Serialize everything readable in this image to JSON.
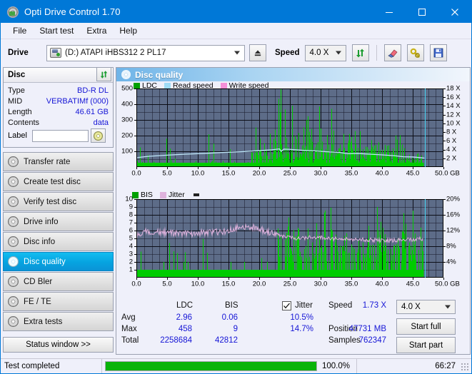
{
  "window": {
    "title": "Opti Drive Control 1.70",
    "icon": "disc-icon",
    "minimize": "—",
    "maximize": "□",
    "close": "✕"
  },
  "menu": {
    "items": [
      "File",
      "Start test",
      "Extra",
      "Help"
    ]
  },
  "toolbar": {
    "drive_label": "Drive",
    "drive_value": "(D:)  ATAPI iHBS312  2 PL17",
    "eject_title": "Eject",
    "speed_label": "Speed",
    "speed_value": "4.0 X",
    "refresh_title": "Refresh",
    "erase_title": "Erase",
    "tools_title": "Tools",
    "save_title": "Save"
  },
  "disc": {
    "header": "Disc",
    "rows": [
      {
        "key": "Type",
        "value": "BD-R DL"
      },
      {
        "key": "MID",
        "value": "VERBATIMf (000)"
      },
      {
        "key": "Length",
        "value": "46.61 GB"
      },
      {
        "key": "Contents",
        "value": "data"
      }
    ],
    "label_key": "Label",
    "label_value": "",
    "label_placeholder": ""
  },
  "nav": {
    "items": [
      {
        "label": "Transfer rate",
        "active": false
      },
      {
        "label": "Create test disc",
        "active": false
      },
      {
        "label": "Verify test disc",
        "active": false
      },
      {
        "label": "Drive info",
        "active": false
      },
      {
        "label": "Disc info",
        "active": false
      },
      {
        "label": "Disc quality",
        "active": true
      },
      {
        "label": "CD Bler",
        "active": false
      },
      {
        "label": "FE / TE",
        "active": false
      },
      {
        "label": "Extra tests",
        "active": false
      }
    ],
    "status_window": "Status window >>"
  },
  "panel": {
    "title": "Disc quality"
  },
  "chart_data": [
    {
      "type": "area",
      "id": "ldc-chart",
      "title": "",
      "xlabel": "GB",
      "ylabel": "",
      "xlim": [
        0,
        50
      ],
      "ylim": [
        0,
        500
      ],
      "y2lim": [
        0,
        18
      ],
      "grid": true,
      "legend_position": "top-left",
      "legend": [
        {
          "name": "LDC",
          "color": "#00a000"
        },
        {
          "name": "Read speed",
          "color": "#9fdcf5"
        },
        {
          "name": "Write speed",
          "color": "#f58fd8"
        }
      ],
      "xticks": [
        "0.0",
        "5.0",
        "10.0",
        "15.0",
        "20.0",
        "25.0",
        "30.0",
        "35.0",
        "40.0",
        "45.0",
        "50.0 GB"
      ],
      "yticks": [
        "100",
        "200",
        "300",
        "400",
        "500"
      ],
      "y2ticks": [
        "2 X",
        "4 X",
        "6 X",
        "8 X",
        "10 X",
        "12 X",
        "14 X",
        "16 X",
        "18 X"
      ],
      "cursor_x": 47.0,
      "series": [
        {
          "name": "LDC",
          "color": "#00cc00",
          "kind": "spikes",
          "x_end": 46.8,
          "baseline": 25,
          "values": [
            40,
            28,
            55,
            31,
            180,
            22,
            46,
            27,
            30,
            120,
            41,
            26,
            33,
            19,
            24,
            160,
            28,
            21,
            34,
            25,
            18,
            30,
            23,
            27,
            48,
            22,
            19,
            26,
            31,
            20,
            24,
            17,
            36,
            21,
            29,
            18,
            23,
            25,
            20,
            34,
            22,
            175,
            28,
            19,
            31,
            26,
            170,
            23,
            35,
            21,
            27,
            19,
            24,
            180,
            30,
            22,
            26,
            18,
            33,
            21,
            25,
            17,
            29,
            23,
            19,
            26,
            31,
            20,
            24,
            28,
            22,
            18,
            35,
            21,
            27,
            19,
            30,
            23,
            26,
            20,
            24,
            17,
            33,
            21,
            25,
            29,
            19,
            23,
            27,
            18,
            31,
            22,
            26,
            20,
            24,
            34,
            19,
            28,
            21,
            25,
            290,
            40,
            33,
            26,
            120,
            31,
            22,
            205,
            29,
            24,
            35,
            27,
            19,
            33,
            26,
            22,
            30,
            24,
            28,
            20,
            31,
            26,
            22,
            36,
            29,
            24,
            27,
            21,
            33,
            25,
            130,
            28,
            22,
            31,
            26,
            24,
            29,
            21,
            35,
            27,
            22,
            26,
            31,
            24,
            28,
            20,
            33,
            26,
            22,
            29,
            24,
            31,
            27,
            23,
            35,
            26,
            22,
            30,
            25,
            28,
            310,
            120,
            210,
            95,
            160,
            88,
            230,
            105,
            195,
            130,
            175,
            92,
            250,
            118,
            200,
            85,
            145,
            110,
            265,
            98,
            175,
            140,
            220,
            105,
            190,
            128,
            240,
            115,
            165,
            95,
            205,
            150,
            185,
            120,
            270,
            102,
            230,
            145,
            175,
            112,
            290,
            128,
            215,
            160,
            245,
            118,
            195,
            135,
            330,
            108,
            185,
            150,
            260,
            122,
            210,
            175,
            300,
            140,
            235,
            118,
            460,
            160,
            285,
            200,
            245,
            175,
            310,
            190,
            265,
            150,
            330,
            205,
            290,
            178,
            250,
            195,
            315,
            165,
            275,
            210,
            240,
            185,
            300,
            160,
            270,
            195,
            335,
            175,
            245,
            210,
            290,
            165,
            255,
            198,
            310,
            180,
            270,
            205,
            240,
            175,
            180,
            140,
            210,
            165,
            150,
            190,
            130,
            175,
            200,
            145,
            165,
            185,
            120,
            155,
            195,
            140,
            175,
            160,
            130,
            185,
            165,
            130,
            195,
            150,
            175,
            120,
            160,
            185,
            140,
            170,
            125,
            155,
            190,
            135,
            165,
            145,
            180,
            130,
            160,
            150,
            175,
            140,
            120,
            165,
            185,
            130,
            150,
            170,
            125,
            160,
            140,
            180,
            115,
            155,
            135,
            170,
            120,
            150,
            130,
            165,
            140,
            115,
            160,
            130,
            150,
            120,
            135,
            165,
            110,
            145,
            125,
            155,
            105,
            140,
            120,
            150,
            115,
            135,
            125,
            145,
            130,
            110,
            140,
            120,
            100,
            135,
            115,
            125,
            105,
            130,
            110,
            120,
            100,
            125,
            108,
            118,
            98,
            122,
            105,
            115,
            110,
            95,
            120,
            100,
            85,
            115,
            95,
            105,
            90,
            110,
            88,
            100,
            82,
            105,
            90,
            98,
            80,
            100,
            88,
            95,
            90,
            75,
            95,
            82,
            70,
            88,
            78,
            85,
            72,
            90,
            70,
            80,
            65,
            85,
            72,
            78,
            62,
            80,
            70,
            75
          ]
        },
        {
          "name": "Read speed",
          "color": "#b8e4f8",
          "kind": "line",
          "note": "rises ~2.2X at 0 GB to ~4.2X around 23 GB, then declines to ~2.1X at 47 GB"
        },
        {
          "name": "Write speed",
          "color": "#f58fd8",
          "kind": "line",
          "values": []
        }
      ]
    },
    {
      "type": "area",
      "id": "bis-chart",
      "title": "",
      "xlabel": "GB",
      "ylabel": "",
      "xlim": [
        0,
        50
      ],
      "ylim": [
        0,
        10
      ],
      "y2lim": [
        0,
        20
      ],
      "grid": true,
      "legend_position": "top-left",
      "legend": [
        {
          "name": "BIS",
          "color": "#00a000"
        },
        {
          "name": "Jitter",
          "color": "#dfb2dd"
        }
      ],
      "xticks": [
        "0.0",
        "5.0",
        "10.0",
        "15.0",
        "20.0",
        "25.0",
        "30.0",
        "35.0",
        "40.0",
        "45.0",
        "50.0 GB"
      ],
      "yticks": [
        "1",
        "2",
        "3",
        "4",
        "5",
        "6",
        "7",
        "8",
        "9",
        "10"
      ],
      "y2ticks": [
        "4%",
        "8%",
        "12%",
        "16%",
        "20%"
      ],
      "cursor_x": 47.0,
      "series": [
        {
          "name": "BIS",
          "color": "#00cc00",
          "kind": "spikes",
          "x_end": 46.8,
          "baseline": 1,
          "note": "baseline 1 across disc; sparse spikes to 2-4 before 23 GB, dense spikes 3-9 after 23 GB"
        },
        {
          "name": "Jitter",
          "color": "#dfb2dd",
          "kind": "line",
          "unit": "%",
          "note": "noisy band ~10.5-12.5% (0-15 GB), peaks ~14% near 17-19 GB, settles ~9-10% after 25 GB"
        }
      ]
    }
  ],
  "stats": {
    "col_headers": [
      "LDC",
      "BIS"
    ],
    "rows": [
      {
        "label": "Avg",
        "ldc": "2.96",
        "bis": "0.06",
        "jitter": "10.5%"
      },
      {
        "label": "Max",
        "ldc": "458",
        "bis": "9",
        "jitter": "14.7%"
      },
      {
        "label": "Total",
        "ldc": "2258684",
        "bis": "42812",
        "jitter": ""
      }
    ],
    "jitter_label": "Jitter",
    "jitter_checked": true,
    "speed_label": "Speed",
    "speed_value": "1.73 X",
    "position_label": "Position",
    "position_value": "47731 MB",
    "samples_label": "Samples",
    "samples_value": "762347",
    "speed_select_value": "4.0 X",
    "start_full_label": "Start full",
    "start_part_label": "Start part"
  },
  "statusbar": {
    "text": "Test completed",
    "progress_percent": "100.0%",
    "progress_value": 100,
    "elapsed": "66:27"
  },
  "colors": {
    "accent": "#0078d7",
    "plot_bg": "#5d6c88",
    "green": "#00cc00",
    "jitter": "#dfb2dd",
    "read_speed": "#b8e4f8",
    "value_blue": "#1616d6",
    "progress_green": "#09b309"
  }
}
